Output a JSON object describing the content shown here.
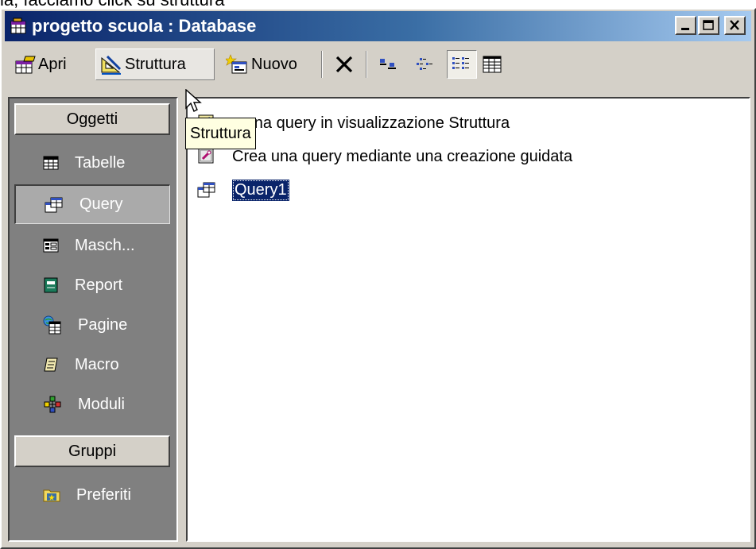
{
  "caption": "la, facciamo click su struttura",
  "window": {
    "title": "progetto scuola : Database"
  },
  "toolbar": {
    "apri_label": "Apri",
    "struttura_label": "Struttura",
    "nuovo_label": "Nuovo"
  },
  "sidebar": {
    "objects_header": "Oggetti",
    "items": [
      {
        "label": "Tabelle",
        "icon": "table-icon"
      },
      {
        "label": "Query",
        "icon": "query-icon"
      },
      {
        "label": "Masch...",
        "icon": "form-icon"
      },
      {
        "label": "Report",
        "icon": "report-icon"
      },
      {
        "label": "Pagine",
        "icon": "page-icon"
      },
      {
        "label": "Macro",
        "icon": "macro-icon"
      },
      {
        "label": "Moduli",
        "icon": "module-icon"
      }
    ],
    "groups_header": "Gruppi",
    "groups": [
      {
        "label": "Preferiti",
        "icon": "favorites-icon"
      }
    ]
  },
  "list": {
    "items": [
      {
        "label": "a una query in visualizzazione Struttura",
        "icon": "design-wizard-icon"
      },
      {
        "label": "Crea una query mediante una creazione guidata",
        "icon": "wizard-icon"
      },
      {
        "label": "Query1",
        "icon": "query-icon"
      }
    ]
  },
  "tooltip": "Struttura"
}
